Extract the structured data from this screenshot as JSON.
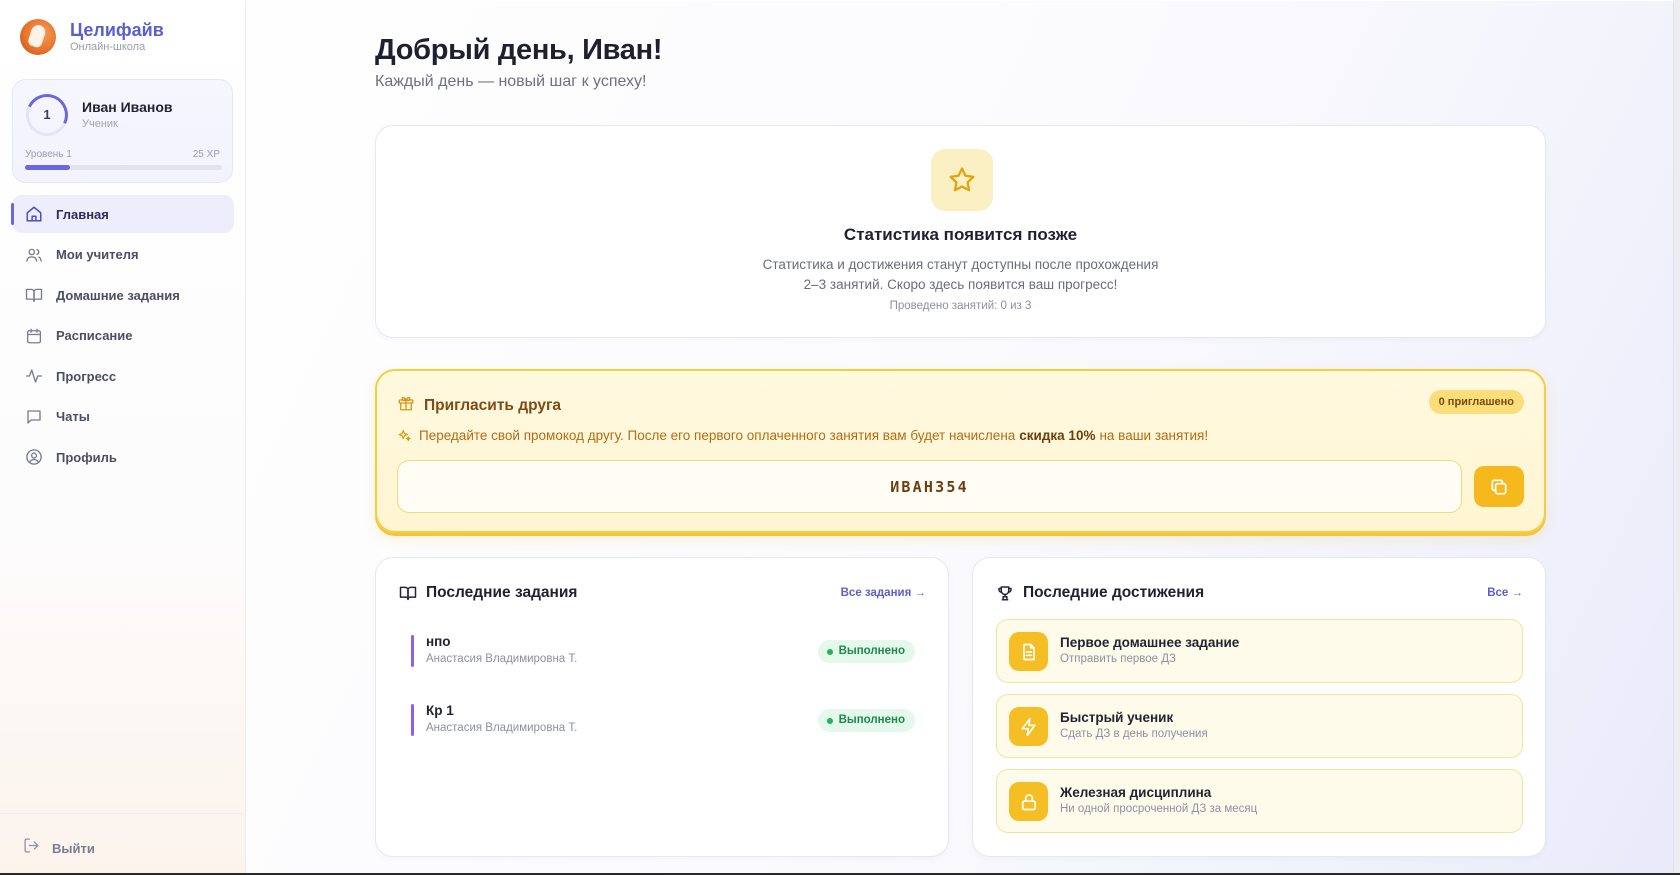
{
  "brand": {
    "name": "Целифайв",
    "subtitle": "Онлайн-школа"
  },
  "user": {
    "name": "Иван Иванов",
    "role": "Ученик",
    "level": "1",
    "level_label": "Уровень 1",
    "xp_label": "25 XP",
    "xp_progress": 0.23
  },
  "nav": {
    "items": [
      {
        "label": "Главная",
        "icon": "home-icon",
        "active": true
      },
      {
        "label": "Мои учителя",
        "icon": "users-icon",
        "active": false
      },
      {
        "label": "Домашние задания",
        "icon": "book-icon",
        "active": false
      },
      {
        "label": "Расписание",
        "icon": "calendar-icon",
        "active": false
      },
      {
        "label": "Прогресс",
        "icon": "activity-icon",
        "active": false
      },
      {
        "label": "Чаты",
        "icon": "chat-icon",
        "active": false
      },
      {
        "label": "Профиль",
        "icon": "profile-icon",
        "active": false
      }
    ],
    "logout_label": "Выйти"
  },
  "header": {
    "greeting": "Добрый день, Иван!",
    "subtitle": "Каждый день — новый шаг к успеху!"
  },
  "stats": {
    "title": "Статистика появится позже",
    "text_line1": "Статистика и достижения станут доступны после прохождения",
    "text_line2": "2–3 занятий. Скоро здесь появится ваш прогресс!",
    "note": "Проведено занятий: 0 из 3"
  },
  "invite": {
    "title": "Пригласить друга",
    "badge": "0 приглашено",
    "text_before": "Передайте свой промокод другу. После его первого оплаченного занятия вам будет начислена",
    "text_bold": "скидка 10%",
    "text_after": "на ваши занятия!",
    "promo_code": "ИВАН354"
  },
  "tasks": {
    "title": "Последние задания",
    "link": "Все задания →",
    "items": [
      {
        "title": "нпо",
        "teacher": "Анастасия Владимировна Т.",
        "status": "Выполнено"
      },
      {
        "title": "Кр 1",
        "teacher": "Анастасия Владимировна Т.",
        "status": "Выполнено"
      }
    ]
  },
  "achievements": {
    "title": "Последние достижения",
    "link": "Все →",
    "items": [
      {
        "title": "Первое домашнее задание",
        "subtitle": "Отправить первое ДЗ",
        "icon": "document-icon"
      },
      {
        "title": "Быстрый ученик",
        "subtitle": "Сдать ДЗ в день получения",
        "icon": "lightning-icon"
      },
      {
        "title": "Железная дисциплина",
        "subtitle": "Ни одной просроченной ДЗ за месяц",
        "icon": "lock-icon"
      }
    ]
  },
  "colors": {
    "accent": "#6a67e0",
    "brand": "#5a5fd0",
    "gold": "#f5b91d",
    "success": "#22b35a"
  }
}
